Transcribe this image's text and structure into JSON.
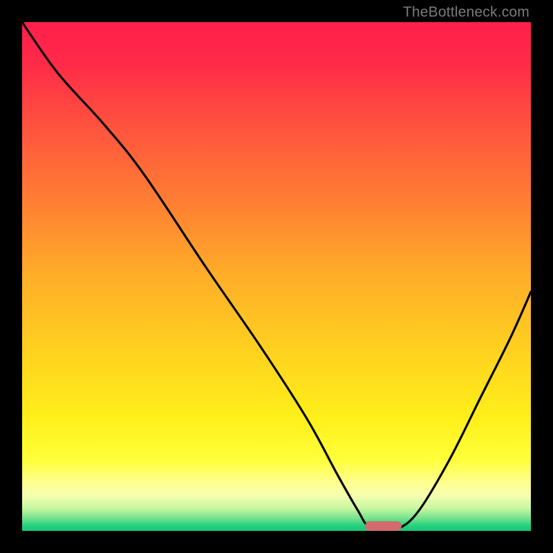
{
  "watermark": "TheBottleneck.com",
  "colors": {
    "frame": "#000000",
    "gradient_stops": [
      {
        "offset": 0.0,
        "color": "#ff1f4b"
      },
      {
        "offset": 0.08,
        "color": "#ff2a48"
      },
      {
        "offset": 0.2,
        "color": "#ff513e"
      },
      {
        "offset": 0.35,
        "color": "#ff7e33"
      },
      {
        "offset": 0.5,
        "color": "#ffae28"
      },
      {
        "offset": 0.65,
        "color": "#ffd21f"
      },
      {
        "offset": 0.78,
        "color": "#fff01a"
      },
      {
        "offset": 0.86,
        "color": "#ffff3a"
      },
      {
        "offset": 0.905,
        "color": "#ffff8f"
      },
      {
        "offset": 0.93,
        "color": "#f6ffb0"
      },
      {
        "offset": 0.955,
        "color": "#c9f7a0"
      },
      {
        "offset": 0.975,
        "color": "#77e28e"
      },
      {
        "offset": 0.99,
        "color": "#23d07f"
      },
      {
        "offset": 1.0,
        "color": "#18c878"
      }
    ],
    "curve": "#000000",
    "marker": "#d36a6d"
  },
  "chart_data": {
    "type": "line",
    "title": "",
    "xlabel": "",
    "ylabel": "",
    "xlim": [
      0,
      100
    ],
    "ylim": [
      0,
      100
    ],
    "grid": false,
    "x": [
      0,
      7,
      16,
      24,
      36,
      47,
      56,
      62,
      66,
      68,
      71,
      74,
      78,
      84,
      90,
      96,
      100
    ],
    "values": [
      100,
      90,
      80,
      70,
      52,
      36,
      22,
      11,
      4,
      1,
      0.5,
      0.5,
      4,
      14,
      26,
      38,
      47
    ],
    "marker": {
      "x_start": 68,
      "x_end": 74,
      "y": 0.5
    }
  }
}
